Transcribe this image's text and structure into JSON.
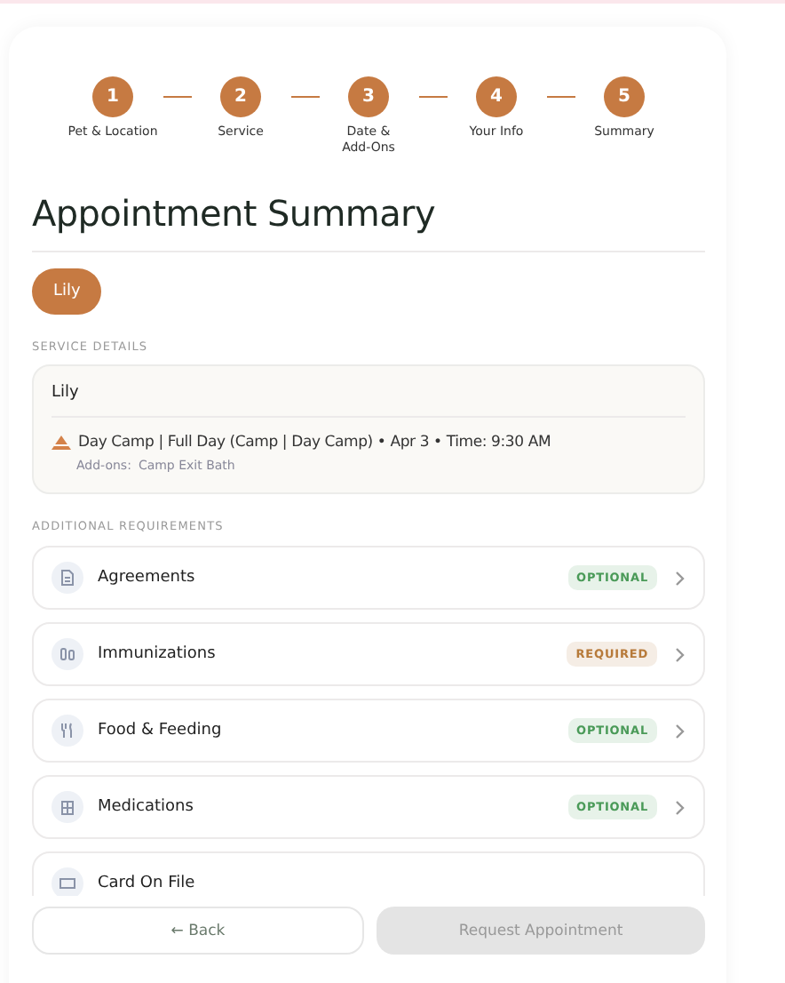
{
  "steps": [
    {
      "number": "1",
      "label": "Pet & Location"
    },
    {
      "number": "2",
      "label": "Service"
    },
    {
      "number": "3",
      "label": "Date & Add-Ons"
    },
    {
      "number": "4",
      "label": "Your Info"
    },
    {
      "number": "5",
      "label": "Summary"
    }
  ],
  "title": "Appointment Summary",
  "pets": [
    {
      "name": "Lily",
      "selected": true
    }
  ],
  "service_details": {
    "heading": "SERVICE DETAILS",
    "pet": "Lily",
    "service": "Day Camp | Full Day (Camp | Day Camp) • Apr 3 • Time: 9:30 AM",
    "addons_label": "Add-ons:",
    "addons": "Camp Exit Bath"
  },
  "requirements": {
    "heading": "ADDITIONAL REQUIREMENTS",
    "items": [
      {
        "label": "Agreements",
        "kind": "document",
        "badge": {
          "text": "OPTIONAL",
          "color": "#4a9a58"
        }
      },
      {
        "label": "Immunizations",
        "kind": "vials",
        "badge": {
          "text": "REQUIRED",
          "color": "#b77a3a"
        }
      },
      {
        "label": "Food & Feeding",
        "kind": "utensils",
        "badge": {
          "text": "OPTIONAL",
          "color": "#4a9a58"
        }
      },
      {
        "label": "Medications",
        "kind": "pillbox",
        "badge": {
          "text": "OPTIONAL",
          "color": "#4a9a58"
        }
      },
      {
        "label": "Card On File",
        "kind": "card"
      }
    ]
  },
  "buttons": {
    "back": "← Back",
    "submit": "Request Appointment",
    "submit_disabled": true
  }
}
